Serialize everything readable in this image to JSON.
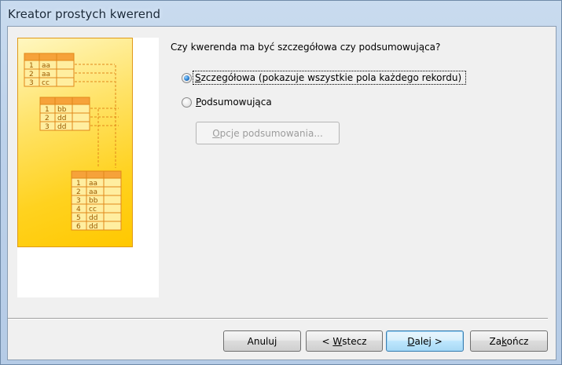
{
  "window": {
    "title": "Kreator prostych kwerend"
  },
  "question": "Czy kwerenda ma być szczegółowa czy podsumowująca?",
  "options": [
    {
      "label": "Szczegółowa (pokazuje wszystkie pola każdego rekordu)",
      "checked": true
    },
    {
      "label": "Podsumowująca",
      "checked": false
    }
  ],
  "summary_button": {
    "label": "Opcje podsumowania...",
    "enabled": false
  },
  "footer": {
    "cancel": "Anuluj",
    "back": "< Wstecz",
    "next": "Dalej >",
    "finish": "Zakończ"
  },
  "illustration": {
    "table1": [
      [
        "1",
        "aa"
      ],
      [
        "2",
        "aa"
      ],
      [
        "3",
        "cc"
      ]
    ],
    "table2": [
      [
        "1",
        "bb"
      ],
      [
        "2",
        "dd"
      ],
      [
        "3",
        "dd"
      ]
    ],
    "result": [
      [
        "1",
        "aa"
      ],
      [
        "2",
        "aa"
      ],
      [
        "3",
        "bb"
      ],
      [
        "4",
        "cc"
      ],
      [
        "5",
        "dd"
      ],
      [
        "6",
        "dd"
      ]
    ]
  },
  "colors": {
    "accent": "#e09a1a",
    "illus_bg": "#ffd21f",
    "default_button": "#3c7fb1"
  }
}
